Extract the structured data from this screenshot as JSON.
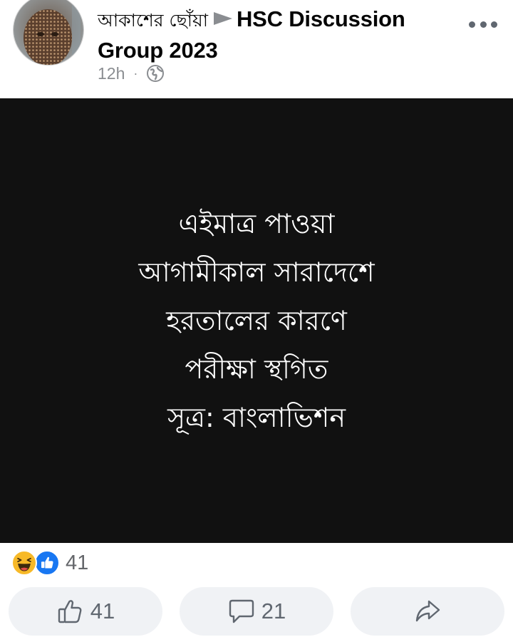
{
  "post": {
    "author_name": "আকাশের ছোঁয়া",
    "group_name": "HSC Discussion Group 2023",
    "time": "12h",
    "separator": "·",
    "audience_icon": "globe-icon"
  },
  "image": {
    "background": "#111111",
    "lines": [
      "এইমাত্র পাওয়া",
      "আগামীকাল সারাদেশে",
      "হরতালের কারণে",
      "পরীক্ষা স্থগিত",
      "সূত্র: বাংলাভিশন"
    ]
  },
  "reactions": {
    "icons": [
      "haha-icon",
      "like-icon"
    ],
    "count": "41"
  },
  "actions": {
    "like_count": "41",
    "comment_count": "21"
  },
  "colors": {
    "like_blue": "#1877f2",
    "haha_yellow": "#f7b928",
    "secondary_text": "#65676b",
    "button_bg": "#f0f2f5"
  }
}
